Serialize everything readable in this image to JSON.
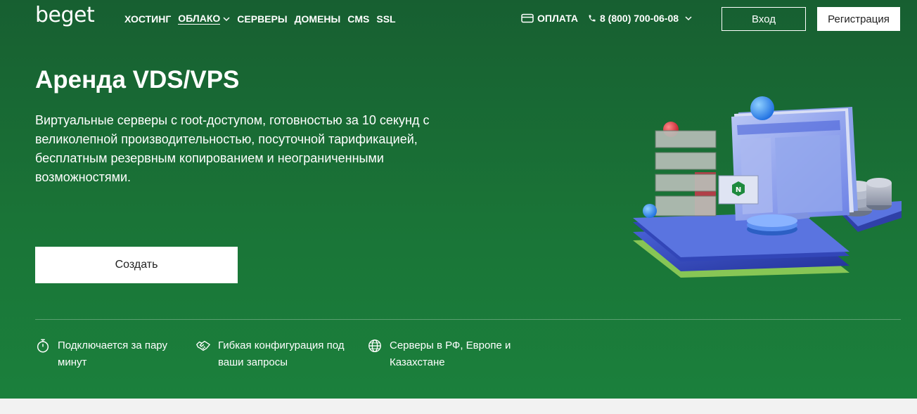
{
  "header": {
    "logo": "beget",
    "nav": [
      {
        "label": "ХОСТИНГ"
      },
      {
        "label": "ОБЛАКО",
        "active": true
      },
      {
        "label": "СЕРВЕРЫ"
      },
      {
        "label": "ДОМЕНЫ"
      },
      {
        "label": "CMS"
      },
      {
        "label": "SSL"
      }
    ],
    "payment_label": "ОПЛАТА",
    "phone": "8 (800) 700-06-08",
    "login_label": "Вход",
    "register_label": "Регистрация"
  },
  "hero": {
    "title": "Аренда VDS/VPS",
    "subtitle": "Виртуальные серверы с root-доступом, готовностью за 10 секунд с великолепной производительностью, посуточной тарификацией, бесплатным резервным копированием и неограниченными возможностями.",
    "create_label": "Создать"
  },
  "features": [
    {
      "icon": "stopwatch-icon",
      "text": "Подключается за пару минут"
    },
    {
      "icon": "handshake-icon",
      "text": "Гибкая конфигурация под ваши запросы"
    },
    {
      "icon": "globe-icon",
      "text": "Серверы в РФ, Европе и Казахстане"
    }
  ],
  "illustration": {
    "badge_letter": "N"
  },
  "colors": {
    "hero_top": "#175f31",
    "hero_bottom": "#1b803c",
    "accent_blue": "#3b82f6"
  }
}
